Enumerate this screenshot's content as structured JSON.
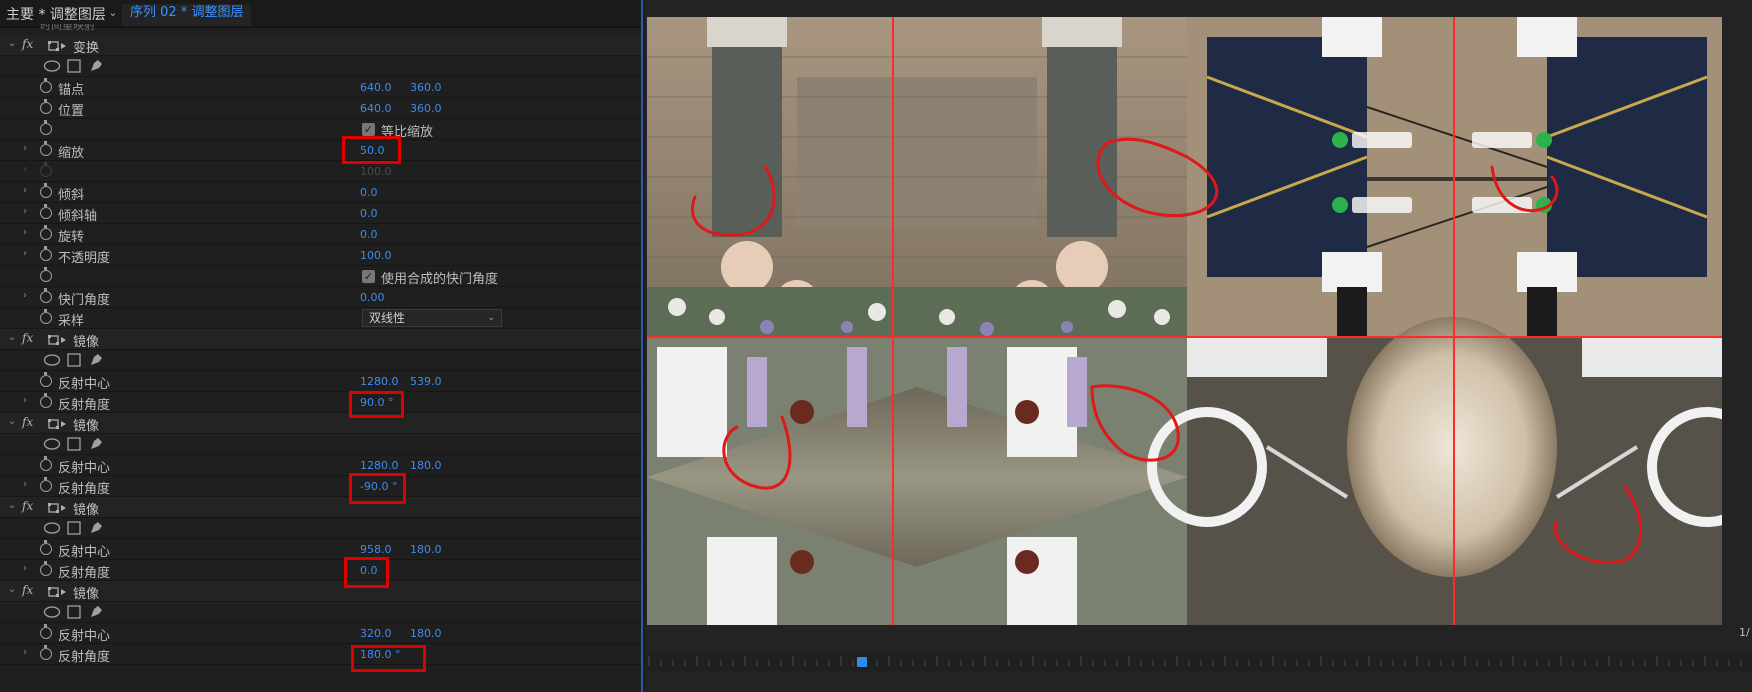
{
  "tabs": {
    "master": "主要 * 调整图层",
    "sequence": "序列 02 * 调整图层"
  },
  "cutoff_text": "时间重映射",
  "sections": {
    "transform": "变换",
    "mirror1": "镜像",
    "mirror2": "镜像",
    "mirror3": "镜像",
    "mirror4": "镜像"
  },
  "fx_label": "fx",
  "transform": {
    "anchor": {
      "label": "锚点",
      "x": "640.0",
      "y": "360.0"
    },
    "position": {
      "label": "位置",
      "x": "640.0",
      "y": "360.0"
    },
    "uniform_scale": {
      "label": "等比缩放",
      "checked": true
    },
    "scale": {
      "label": "缩放",
      "value": "50.0"
    },
    "scale_width": {
      "value": "100.0"
    },
    "skew": {
      "label": "倾斜",
      "value": "0.0"
    },
    "skew_axis": {
      "label": "倾斜轴",
      "value": "0.0"
    },
    "rotation": {
      "label": "旋转",
      "value": "0.0"
    },
    "opacity": {
      "label": "不透明度",
      "value": "100.0"
    },
    "composition_shutter": {
      "label": "使用合成的快门角度",
      "checked": true
    },
    "shutter_angle": {
      "label": "快门角度",
      "value": "0.00"
    },
    "sampling": {
      "label": "采样",
      "value": "双线性"
    }
  },
  "mirror1": {
    "center_label": "反射中心",
    "cx": "1280.0",
    "cy": "539.0",
    "angle_label": "反射角度",
    "angle": "90.0 °"
  },
  "mirror2": {
    "center_label": "反射中心",
    "cx": "1280.0",
    "cy": "180.0",
    "angle_label": "反射角度",
    "angle": "-90.0 °"
  },
  "mirror3": {
    "center_label": "反射中心",
    "cx": "958.0",
    "cy": "180.0",
    "angle_label": "反射角度",
    "angle": "0.0"
  },
  "mirror4": {
    "center_label": "反射中心",
    "cx": "320.0",
    "cy": "180.0",
    "angle_label": "反射角度",
    "angle": "180.0 °"
  },
  "monitor": {
    "page_fraction": "1/",
    "guide_color": "#ff2a2a"
  },
  "colors": {
    "accent_blue": "#3d8cf0",
    "highlight_red": "#e00000"
  }
}
